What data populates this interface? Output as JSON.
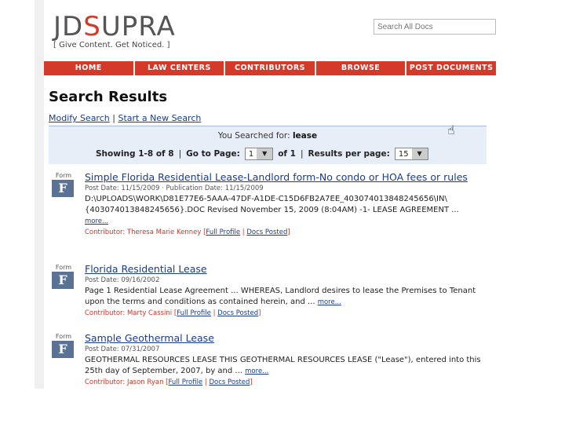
{
  "logo": {
    "part1": "JD",
    "part2": "S",
    "part3": "UPRA",
    "tagline": "[ Give Content. Get Noticed. ]"
  },
  "search": {
    "placeholder": "Search All Docs"
  },
  "nav": [
    "HOME",
    "LAW CENTERS",
    "CONTRIBUTORS",
    "BROWSE",
    "POST DOCUMENTS"
  ],
  "page_title": "Search Results",
  "links": {
    "modify": "Modify Search",
    "sep": "|",
    "new": "Start a New Search"
  },
  "info": {
    "searched_prefix": "You Searched for:",
    "searched_term": "lease",
    "showing": "Showing 1-8 of 8",
    "goto_label": "Go to Page:",
    "page_value": "1",
    "of_label": "of 1",
    "rpp_label": "Results per page:",
    "rpp_value": "15"
  },
  "results": [
    {
      "badge_form": "Form",
      "badge_letter": "F",
      "title": "Simple Florida Residential Lease-Landlord form-No condo or HOA fees or rules",
      "date": "Post Date: 11/15/2009 · Publication Date: 11/15/2009",
      "snippet": "D:\\UPLOADS\\WORK\\D81E77E6-5AAA-47DF-A1DE-C15D6FB2A7EE_403074013848245656\\IN\\{403074013848245656}.DOC Revised November 15, 2009 (8:04AM) -1- LEASE AGREEMENT ...",
      "more": "more...",
      "contrib_label": "Contributor:",
      "contrib_name": "Theresa Marie Kenney",
      "full_profile": "Full Profile",
      "docs_posted": "Docs Posted"
    },
    {
      "badge_form": "Form",
      "badge_letter": "F",
      "title": "Florida Residential Lease",
      "date": "Post Date: 09/16/2002",
      "snippet": "Page 1  Residential Lease Agreement ... WHEREAS, Landlord desires to lease the Premises to Tenant upon the terms and conditions as contained herein, and ...",
      "more": "more...",
      "contrib_label": "Contributor:",
      "contrib_name": "Marty Cassini",
      "full_profile": "Full Profile",
      "docs_posted": "Docs Posted"
    },
    {
      "badge_form": "Form",
      "badge_letter": "F",
      "title": "Sample Geothermal Lease",
      "date": "Post Date: 07/31/2007",
      "snippet": "GEOTHERMAL RESOURCES LEASE  THIS GEOTHERMAL RESOURCES LEASE (\"Lease\"), entered into this 25th day of September, 2007, by and ...",
      "more": "more...",
      "contrib_label": "Contributor:",
      "contrib_name": "Jason Ryan",
      "full_profile": "Full Profile",
      "docs_posted": "Docs Posted"
    }
  ]
}
